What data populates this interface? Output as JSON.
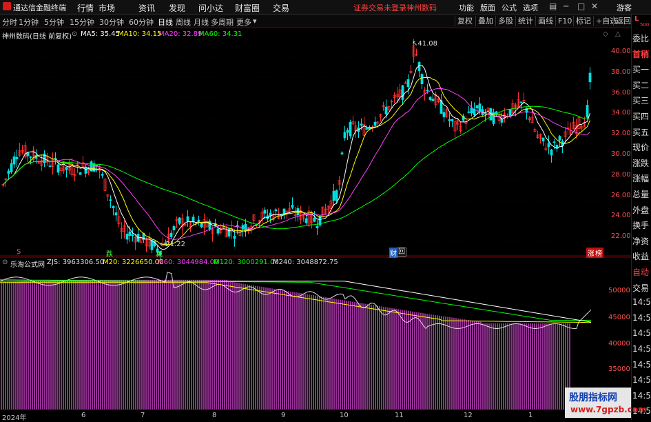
{
  "titlebar": {
    "app_name": "通达信金融终端",
    "menus": [
      "行情",
      "市场",
      "资讯",
      "发现",
      "问小达",
      "财富圈",
      "交易"
    ],
    "notice": "证券交易未登录",
    "stock_name": "神州数码",
    "right_menus": [
      "功能",
      "版面",
      "公式",
      "选项"
    ],
    "guest": "游客"
  },
  "toolbar": {
    "periods": [
      "分时",
      "1分钟",
      "5分钟",
      "15分钟",
      "30分钟",
      "60分钟",
      "日线",
      "周线",
      "月线",
      "多周期",
      "更多"
    ],
    "active_period": "日线",
    "right_buttons": [
      "复权",
      "叠加",
      "多股",
      "统计",
      "画线",
      "F10",
      "标记",
      "+自选",
      "返回"
    ]
  },
  "chart_header": {
    "title": "神州数码(日线 前复权)",
    "ma5": "MA5: 35.45",
    "ma10": "MA10: 34.15",
    "ma20": "MA20: 32.89",
    "ma60": "MA60: 34.31"
  },
  "price_axis": [
    "40.00",
    "38.00",
    "36.00",
    "34.00",
    "32.00",
    "30.00",
    "28.00",
    "26.00",
    "24.00",
    "22.00"
  ],
  "annotations": {
    "high": "41.08",
    "low": "21.22"
  },
  "markers": [
    "S",
    "跌",
    "减",
    "财",
    "回",
    "涨",
    "榜"
  ],
  "indicator_header": {
    "name": "乐淘公式网",
    "zjs": "ZJS: 3963306.50",
    "m20": "M20: 3226650.00",
    "m60": "M60: 3044984.00",
    "m120": "M120: 3000291.00",
    "m240": "M240: 3048872.75"
  },
  "indicator_axis": [
    "50000",
    "45000",
    "40000",
    "35000"
  ],
  "x_axis": [
    "2024年",
    "6",
    "7",
    "8",
    "9",
    "10",
    "11",
    "12",
    "1"
  ],
  "right_panel": {
    "top": [
      "L",
      "500"
    ],
    "items": [
      "委比",
      "首稍",
      "买一",
      "买二",
      "买三",
      "买四",
      "买五",
      "现价",
      "涨跌",
      "涨幅",
      "总量",
      "外盘",
      "换手",
      "净资",
      "收益",
      "自动",
      "交易",
      "14:5",
      "14:5",
      "14:5",
      "14:5",
      "14:5",
      "14:5",
      "14:5",
      "14:5"
    ]
  },
  "watermark": {
    "line1": "股朋指标网",
    "line2": "www.7gpzb.com"
  },
  "colors": {
    "up": "#ff3030",
    "down": "#00e0e0",
    "ma5": "#ffffff",
    "ma10": "#ffff00",
    "ma20": "#ff40ff",
    "ma60": "#00ff00"
  }
}
